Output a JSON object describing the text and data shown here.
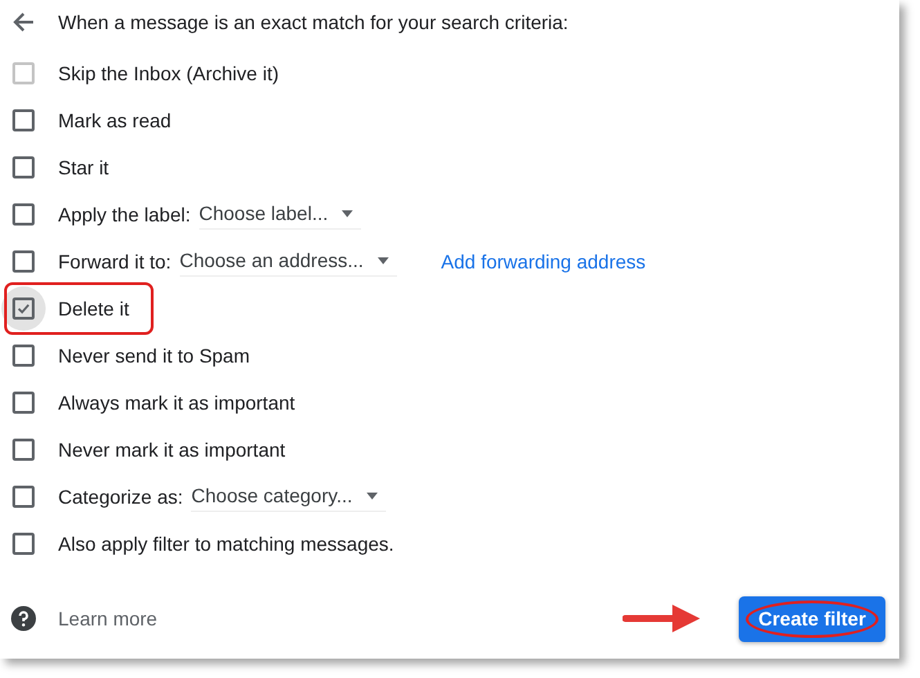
{
  "header": {
    "title": "When a message is an exact match for your search criteria:"
  },
  "options": [
    {
      "kind": "plain",
      "label": "Skip the Inbox (Archive it)",
      "checked": false,
      "disabled": true,
      "highlighted": false
    },
    {
      "kind": "plain",
      "label": "Mark as read",
      "checked": false,
      "disabled": false,
      "highlighted": false
    },
    {
      "kind": "plain",
      "label": "Star it",
      "checked": false,
      "disabled": false,
      "highlighted": false
    },
    {
      "kind": "select",
      "label": "Apply the label:",
      "select": "Choose label...",
      "checked": false,
      "disabled": false,
      "highlighted": false
    },
    {
      "kind": "select",
      "label": "Forward it to:",
      "select": "Choose an address...",
      "link": "Add forwarding address",
      "checked": false,
      "disabled": false,
      "highlighted": false
    },
    {
      "kind": "plain",
      "label": "Delete it",
      "checked": true,
      "disabled": false,
      "highlighted": true
    },
    {
      "kind": "plain",
      "label": "Never send it to Spam",
      "checked": false,
      "disabled": false,
      "highlighted": false
    },
    {
      "kind": "plain",
      "label": "Always mark it as important",
      "checked": false,
      "disabled": false,
      "highlighted": false
    },
    {
      "kind": "plain",
      "label": "Never mark it as important",
      "checked": false,
      "disabled": false,
      "highlighted": false
    },
    {
      "kind": "select",
      "label": "Categorize as:",
      "select": "Choose category...",
      "checked": false,
      "disabled": false,
      "highlighted": false
    },
    {
      "kind": "plain",
      "label": "Also apply filter to matching messages.",
      "checked": false,
      "disabled": false,
      "highlighted": false
    }
  ],
  "footer": {
    "learn_more": "Learn more",
    "create_button": "Create filter"
  }
}
